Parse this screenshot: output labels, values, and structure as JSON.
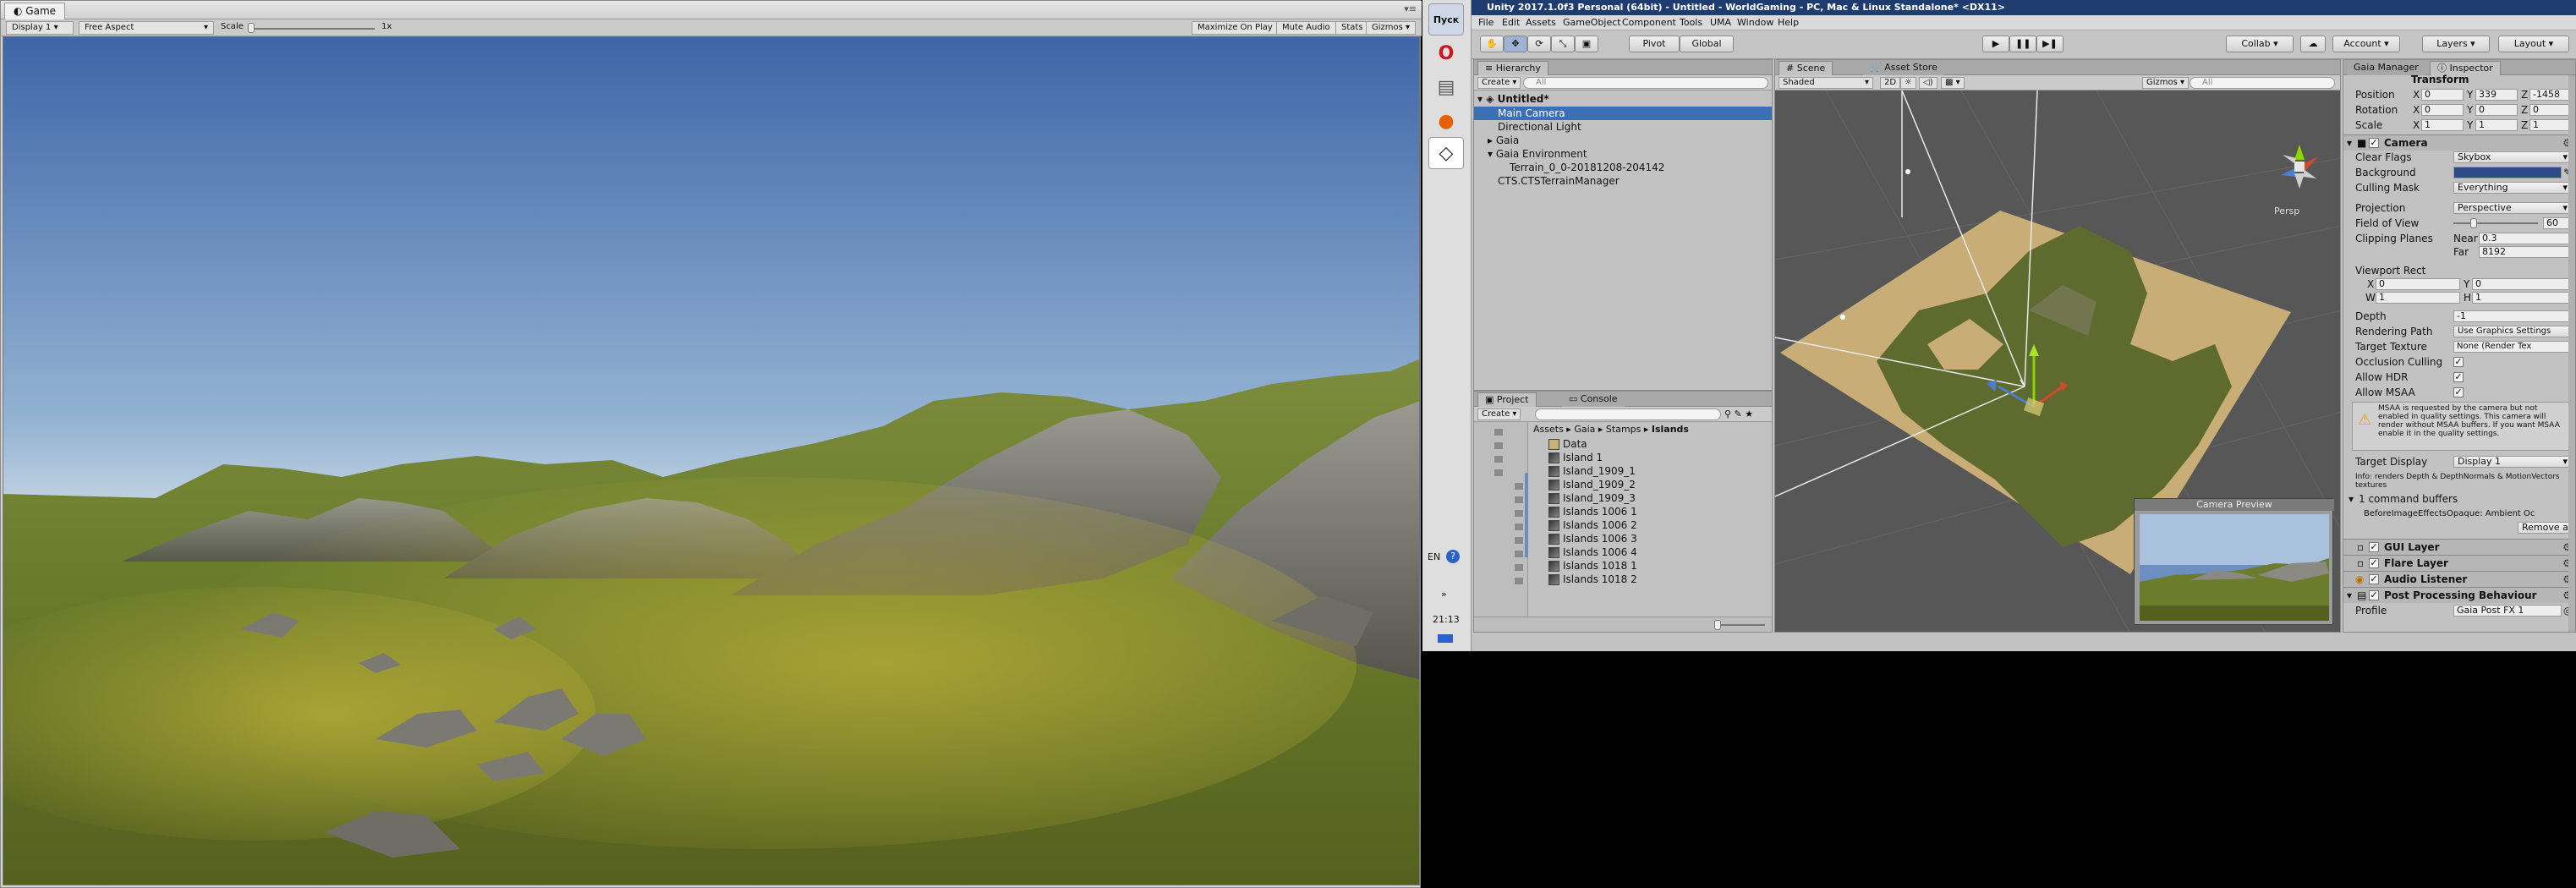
{
  "game": {
    "tab_label": "Game",
    "display": "Display 1",
    "aspect": "Free Aspect",
    "scale_label": "Scale",
    "scale_value": "1x",
    "maximize_on_play": "Maximize On Play",
    "mute_audio": "Mute Audio",
    "stats": "Stats",
    "gizmos": "Gizmos"
  },
  "taskbar": {
    "start_label": "Пуск",
    "lang": "EN",
    "time": "21:13",
    "expand": "»"
  },
  "unity": {
    "title": "Unity 2017.1.0f3 Personal (64bit) - Untitled - WorldGaming - PC, Mac & Linux Standalone* <DX11>",
    "menu": [
      "File",
      "Edit",
      "Assets",
      "GameObject",
      "Component",
      "Tools",
      "UMA",
      "Window",
      "Help"
    ],
    "toolbar": {
      "pivot": "Pivot",
      "global": "Global",
      "collab": "Collab",
      "account": "Account",
      "layers": "Layers",
      "layout": "Layout"
    }
  },
  "hierarchy": {
    "tab": "Hierarchy",
    "create": "Create",
    "search_placeholder": "All",
    "scene_name": "Untitled*",
    "items": [
      {
        "label": "Main Camera",
        "selected": true
      },
      {
        "label": "Directional Light"
      },
      {
        "label": "Gaia"
      },
      {
        "label": "Gaia Environment"
      },
      {
        "label": "Terrain_0_0-20181208-204142"
      },
      {
        "label": "CTS.CTSTerrainManager"
      }
    ]
  },
  "project": {
    "tabs": [
      "Project",
      "Console"
    ],
    "create": "Create",
    "breadcrumb": [
      "Assets",
      "Gaia",
      "Stamps",
      "Islands"
    ],
    "assets": [
      "Data",
      "Island 1",
      "Island_1909_1",
      "Island_1909_2",
      "Island_1909_3",
      "Islands 1006 1",
      "Islands 1006 2",
      "Islands 1006 3",
      "Islands 1006 4",
      "Islands 1018 1",
      "Islands 1018 2"
    ]
  },
  "scene": {
    "tabs": [
      "Scene",
      "Asset Store"
    ],
    "shading": "Shaded",
    "mode_2d": "2D",
    "gizmos": "Gizmos",
    "search_placeholder": "All",
    "persp": "Persp",
    "camera_preview": "Camera Preview"
  },
  "inspector": {
    "tabs": [
      "Gaia Manager",
      "Inspector"
    ],
    "transform": {
      "title": "Transform",
      "position_label": "Position",
      "position": {
        "x": "0",
        "y": "339",
        "z": "-1458"
      },
      "rotation_label": "Rotation",
      "rotation": {
        "x": "0",
        "y": "0",
        "z": "0"
      },
      "scale_label": "Scale",
      "scale": {
        "x": "1",
        "y": "1",
        "z": "1"
      }
    },
    "camera": {
      "title": "Camera",
      "clear_flags_label": "Clear Flags",
      "clear_flags": "Skybox",
      "background_label": "Background",
      "culling_mask_label": "Culling Mask",
      "culling_mask": "Everything",
      "projection_label": "Projection",
      "projection": "Perspective",
      "fov_label": "Field of View",
      "fov": "60",
      "clipping_label": "Clipping Planes",
      "near_label": "Near",
      "near": "0.3",
      "far_label": "Far",
      "far": "8192",
      "viewport_label": "Viewport Rect",
      "viewport": {
        "x": "0",
        "y": "0",
        "w": "1",
        "h": "1"
      },
      "depth_label": "Depth",
      "depth": "-1",
      "rendering_path_label": "Rendering Path",
      "rendering_path": "Use Graphics Settings",
      "target_texture_label": "Target Texture",
      "target_texture": "None (Render Tex",
      "occlusion_label": "Occlusion Culling",
      "hdr_label": "Allow HDR",
      "msaa_label": "Allow MSAA",
      "msaa_warning": "MSAA is requested by the camera but not enabled in quality settings. This camera will render without MSAA buffers. If you want MSAA enable it in the quality settings.",
      "target_display_label": "Target Display",
      "target_display": "Display 1",
      "info": "Info: renders Depth & DepthNormals & MotionVectors textures",
      "command_buffers": "1 command buffers",
      "cb_item": "BeforeImageEffectsOpaque: Ambient Oc",
      "remove_all": "Remove all"
    },
    "components": [
      "GUI Layer",
      "Flare Layer",
      "Audio Listener",
      "Post Processing Behaviour"
    ],
    "profile_label": "Profile",
    "profile": "Gaia Post FX 1"
  },
  "colors": {
    "title_bar": "#1f3c70",
    "selection": "#3d6fb6",
    "camera_bg": "#2b4a86"
  }
}
